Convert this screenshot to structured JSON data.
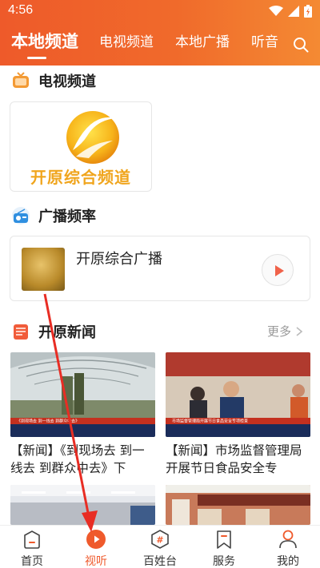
{
  "status": {
    "time": "4:56"
  },
  "top_tabs": [
    {
      "label": "本地频道",
      "active": true
    },
    {
      "label": "电视频道"
    },
    {
      "label": "本地广播"
    },
    {
      "label": "听音"
    }
  ],
  "sections": {
    "tv": {
      "title": "电视频道"
    },
    "radio": {
      "title": "广播频率"
    },
    "news": {
      "title": "开原新闻",
      "more": "更多"
    }
  },
  "tv_channel": {
    "name": "开原综合频道"
  },
  "radio_channel": {
    "name": "开原综合广播"
  },
  "news": [
    {
      "title": "【新闻】《到现场去 到一线去 到群众中去》下",
      "caption": "《到现场去 到一线去 到群众中去》"
    },
    {
      "title": "【新闻】市场监督管理局开展节日食品安全专",
      "caption": "市场监督管理局开展节日食品安全专项检查"
    },
    {
      "title": "",
      "caption": ""
    },
    {
      "title": "",
      "caption": ""
    }
  ],
  "bottom_nav": [
    {
      "label": "首页",
      "icon": "home-icon"
    },
    {
      "label": "视听",
      "icon": "play-icon",
      "active": true
    },
    {
      "label": "百姓台",
      "icon": "hashtag-icon"
    },
    {
      "label": "服务",
      "icon": "bookmark-icon"
    },
    {
      "label": "我的",
      "icon": "user-icon"
    }
  ],
  "colors": {
    "accent": "#ef5a2c",
    "logo_yellow": "#f0a51d"
  }
}
